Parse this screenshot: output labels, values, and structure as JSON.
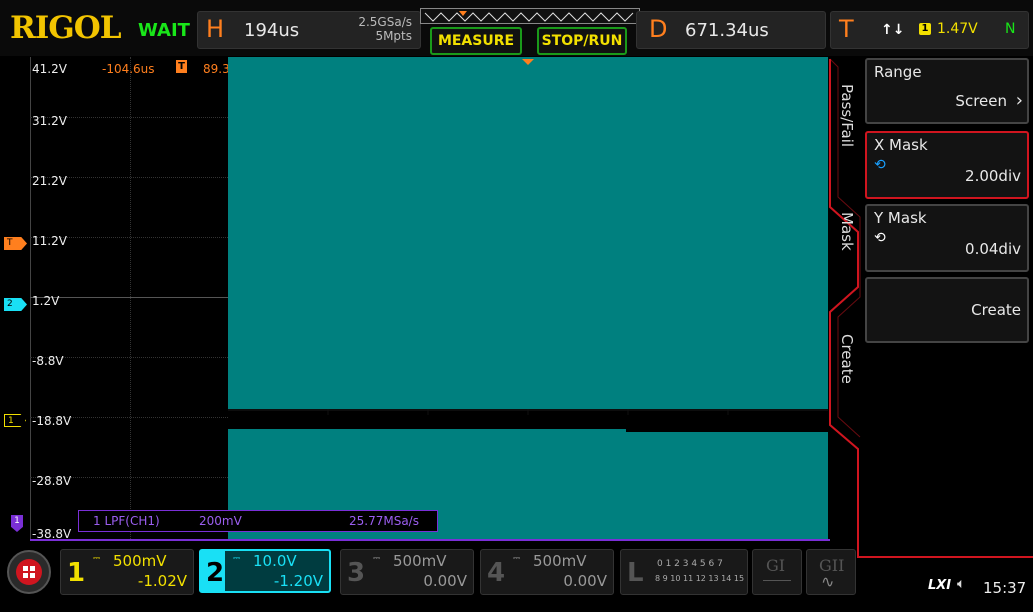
{
  "header": {
    "brand": "RIGOL",
    "run_status": "WAIT",
    "horizontal": {
      "letter": "H",
      "value": "194us"
    },
    "sample": {
      "rate": "2.5GSa/s",
      "depth": "5Mpts"
    },
    "measure_label": "MEASURE",
    "stoprun_label": "STOP/RUN",
    "delay": {
      "letter": "D",
      "value": "671.34us"
    },
    "trigger": {
      "letter": "T",
      "slope": "↑↓",
      "source": "1",
      "level": "1.47V",
      "mode": "N"
    }
  },
  "screen": {
    "cursor_time": "-104.6us",
    "cursor_value_partial": "89.3",
    "y_labels": [
      "41.2V",
      "31.2V",
      "21.2V",
      "11.2V",
      "1.2V",
      "-8.8V",
      "-18.8V",
      "-28.8V",
      "-38.8V"
    ],
    "marker_trigger": "T",
    "marker_ch2": "2",
    "marker_ch1": "1",
    "marker_bottom": "1",
    "filter_info": {
      "name": "1  LPF(CH1)",
      "scale": "200mV",
      "rate": "25.77MSa/s"
    }
  },
  "menu": {
    "tabs": [
      "Pass/Fail",
      "Mask",
      "Create"
    ],
    "range": {
      "label": "Range",
      "value": "Screen"
    },
    "xmask": {
      "label": "X Mask",
      "value": "2.00div"
    },
    "ymask": {
      "label": "Y Mask",
      "value": "0.04div"
    },
    "create": {
      "label": "Create"
    }
  },
  "footer": {
    "channels": [
      {
        "num": "1",
        "scale": "500mV",
        "offset": "-1.02V"
      },
      {
        "num": "2",
        "scale": "10.0V",
        "offset": "-1.20V"
      },
      {
        "num": "3",
        "scale": "500mV",
        "offset": "0.00V"
      },
      {
        "num": "4",
        "scale": "500mV",
        "offset": "0.00V"
      }
    ],
    "logic": {
      "letter": "L",
      "row1": "0 1 2 3  4 5 6 7",
      "row2": "8 9 10 11 12 13 14 15"
    },
    "g1": "GI",
    "g2": "GII",
    "lxi": "LXI",
    "clock": "15:37"
  },
  "colors": {
    "ch1": "#f2e000",
    "ch2": "#19e0f5",
    "ch2_trace": "#00807f",
    "trigger": "#ff7f1e",
    "math": "#7a2fd6",
    "menu_accent": "#d0151f"
  }
}
